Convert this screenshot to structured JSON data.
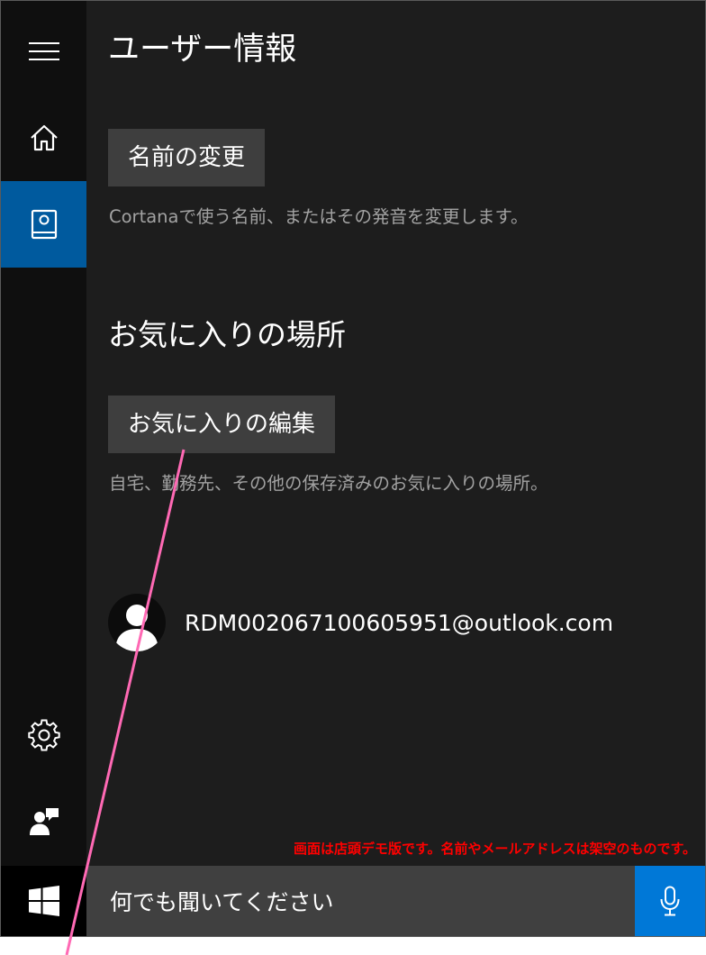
{
  "rail": {
    "items": [
      {
        "icon": "hamburger-menu-icon"
      },
      {
        "icon": "home-icon"
      },
      {
        "icon": "notebook-icon",
        "active": true
      },
      {
        "icon": "gear-icon"
      },
      {
        "icon": "feedback-icon"
      }
    ]
  },
  "page": {
    "title": "ユーザー情報"
  },
  "name_section": {
    "button_label": "名前の変更",
    "description": "Cortanaで使う名前、またはその発音を変更します。"
  },
  "favorites_section": {
    "title": "お気に入りの場所",
    "button_label": "お気に入りの編集",
    "description": "自宅、勤務先、その他の保存済みのお気に入りの場所。"
  },
  "account": {
    "email": "RDM002067100605951@outlook.com",
    "icon": "user-avatar-icon"
  },
  "notice": "画面は店頭デモ版です。名前やメールアドレスは架空のものです。",
  "taskbar": {
    "start_icon": "windows-logo-icon",
    "search_placeholder": "何でも聞いてください",
    "mic_icon": "microphone-icon"
  },
  "colors": {
    "background": "#1d1d1d",
    "rail": "#0f0f0f",
    "active_accent": "#005a9e",
    "button": "#3e3e3e",
    "mic_accent": "#0078d7",
    "annotation_line": "#ff69b4",
    "notice_text": "#ff0000"
  }
}
